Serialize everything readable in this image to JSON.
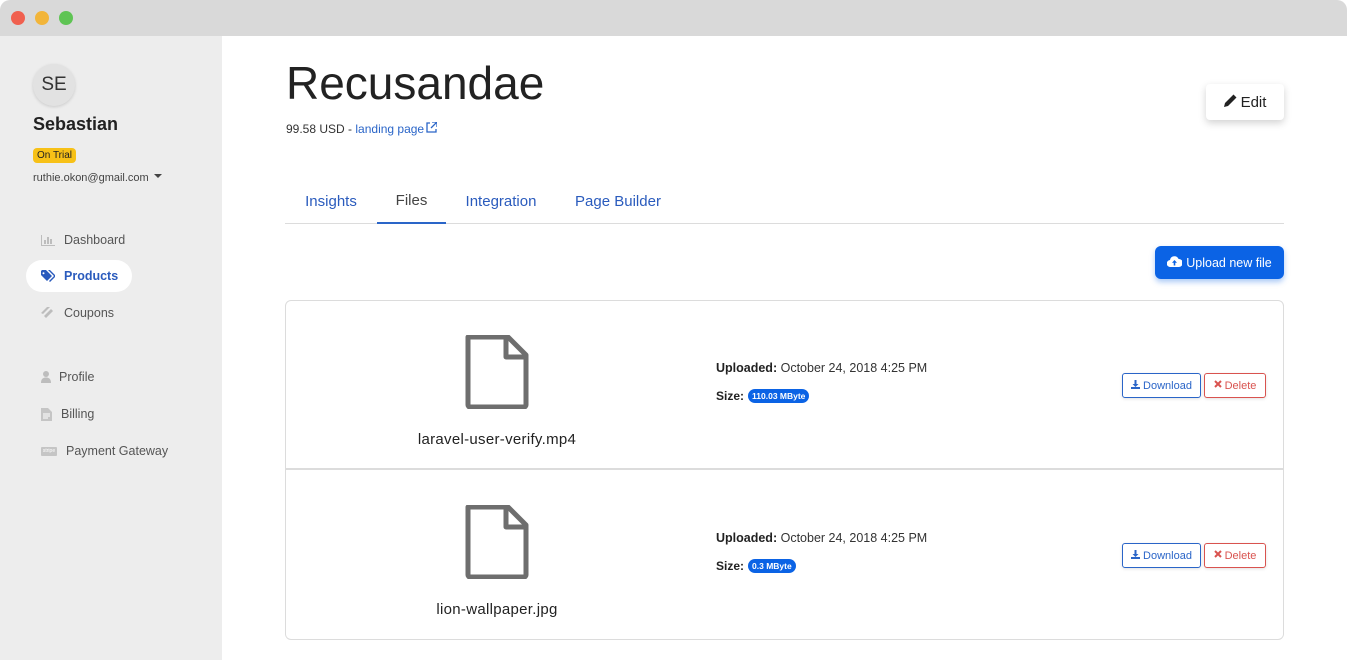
{
  "user": {
    "initials": "SE",
    "name": "Sebastian",
    "badge": "On Trial",
    "email": "ruthie.okon@gmail.com"
  },
  "sidebar": {
    "items": [
      {
        "label": "Dashboard",
        "icon": "bar-chart-icon"
      },
      {
        "label": "Products",
        "icon": "tags-icon",
        "active": true
      },
      {
        "label": "Coupons",
        "icon": "ticket-icon"
      },
      {
        "label": "Profile",
        "icon": "user-icon"
      },
      {
        "label": "Billing",
        "icon": "file-text-icon"
      },
      {
        "label": "Payment Gateway",
        "icon": "stripe-icon",
        "icon_text": "stripe"
      }
    ]
  },
  "product": {
    "title": "Recusandae",
    "price": "99.58 USD",
    "separator": " - ",
    "link_label": "landing page",
    "edit_label": "Edit"
  },
  "tabs": [
    {
      "label": "Insights"
    },
    {
      "label": "Files",
      "active": true
    },
    {
      "label": "Integration"
    },
    {
      "label": "Page Builder"
    }
  ],
  "upload_label": "Upload new file",
  "files": [
    {
      "name": "laravel-user-verify.mp4",
      "uploaded_label": "Uploaded:",
      "uploaded_value": "October 24, 2018 4:25 PM",
      "size_label": "Size:",
      "size_value": "110.03 MByte",
      "download_label": "Download",
      "delete_label": "Delete"
    },
    {
      "name": "lion-wallpaper.jpg",
      "uploaded_label": "Uploaded:",
      "uploaded_value": "October 24, 2018 4:25 PM",
      "size_label": "Size:",
      "size_value": "0.3 MByte",
      "download_label": "Download",
      "delete_label": "Delete"
    }
  ],
  "colors": {
    "accent": "#0b63e5",
    "link": "#2a65c8",
    "danger": "#d9534f",
    "badge": "#f7c117",
    "sidebar_bg": "#ededed"
  }
}
